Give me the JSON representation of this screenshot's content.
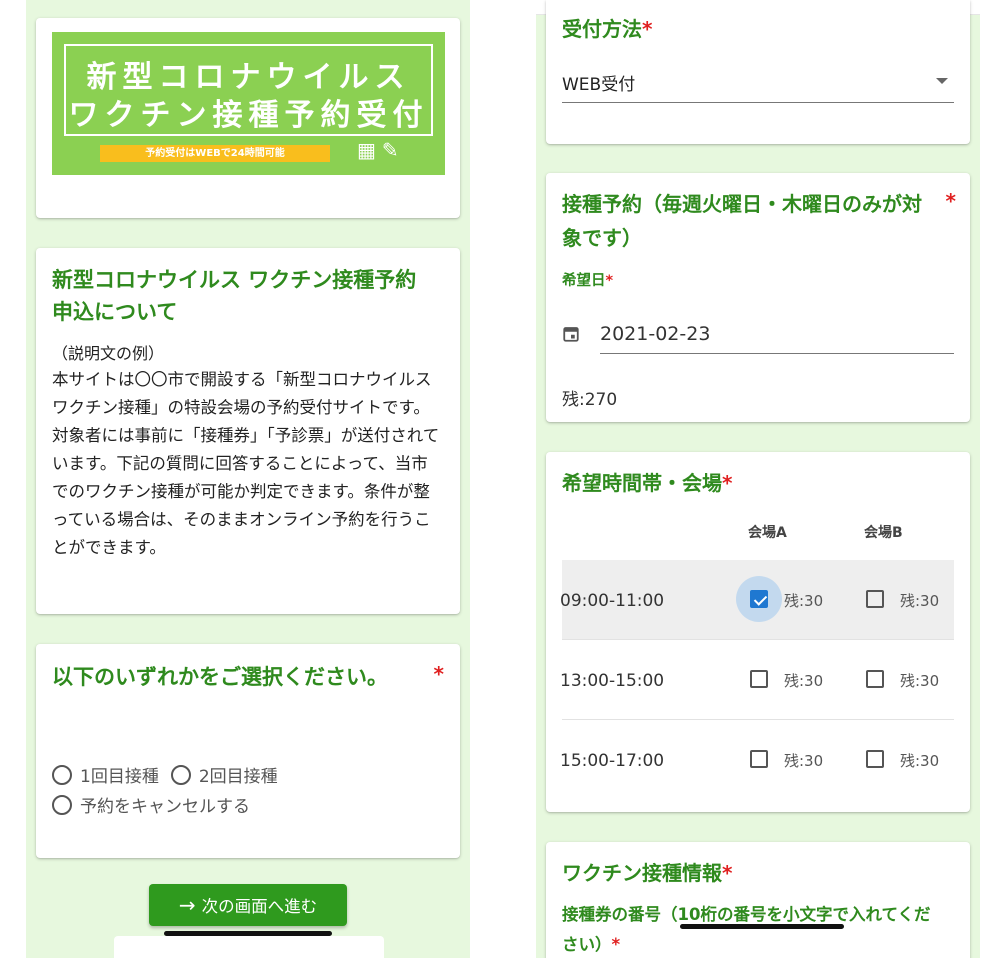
{
  "banner": {
    "line1": "新型コロナウイルス",
    "line2": "ワクチン接種予約受付",
    "strip": "予約受付はWEBで24時間可能"
  },
  "info": {
    "title": "新型コロナウイルス ワクチン接種予約申込について",
    "subtitle": "（説明文の例）",
    "body": "本サイトは〇〇市で開設する「新型コロナウイルスワクチン接種」の特設会場の予約受付サイトです。対象者には事前に「接種券」「予診票」が送付されています。下記の質問に回答することによって、当市でのワクチン接種が可能か判定できます。条件が整っている場合は、そのままオンライン予約を行うことができます。"
  },
  "question": {
    "title": "以下のいずれかをご選択ください。",
    "required": "*",
    "options": [
      "1回目接種",
      "2回目接種",
      "予約をキャンセルする"
    ]
  },
  "next_button": {
    "label": "次の画面へ進む"
  },
  "reception": {
    "title": "受付方法",
    "required": "*",
    "selected": "WEB受付"
  },
  "reservation": {
    "title": "接種予約（毎週火曜日・木曜日のみが対象です）",
    "required": "*",
    "date_label": "希望日",
    "date_value": "2021-02-23",
    "remaining": "残:270"
  },
  "timeslots": {
    "title": "希望時間帯・会場",
    "required": "*",
    "venues": [
      "会場A",
      "会場B"
    ],
    "rows": [
      {
        "time": "09:00-11:00",
        "a_remain": "残:30",
        "b_remain": "残:30",
        "a_checked": true,
        "b_checked": false
      },
      {
        "time": "13:00-15:00",
        "a_remain": "残:30",
        "b_remain": "残:30",
        "a_checked": false,
        "b_checked": false
      },
      {
        "time": "15:00-17:00",
        "a_remain": "残:30",
        "b_remain": "残:30",
        "a_checked": false,
        "b_checked": false
      }
    ]
  },
  "vaccine_info": {
    "title": "ワクチン接種情報",
    "required": "*",
    "ticket_label": "接種券の番号（10桁の番号を小文字で入れてください）"
  },
  "colors": {
    "accent_green": "#2f8a1e",
    "button_green": "#2f9a1e",
    "page_bg": "#e7f8de",
    "banner_green": "#8bd052",
    "check_blue": "#1f78d1"
  },
  "icons": {
    "next": "arrow-right-icon",
    "date": "calendar-icon",
    "select": "caret-down-icon"
  }
}
